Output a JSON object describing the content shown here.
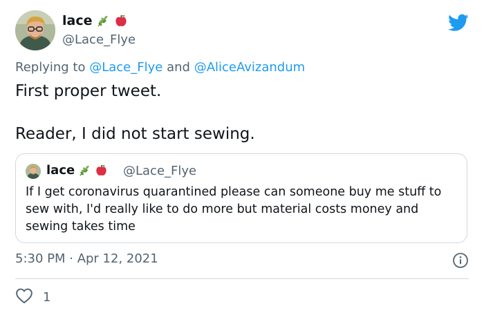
{
  "author": {
    "name": "lace",
    "handle": "@Lace_Flye",
    "emojis": [
      "herb-icon",
      "apple-icon"
    ]
  },
  "reply_context": {
    "prefix": "Replying to",
    "mention1": "@Lace_Flye",
    "conjunction": "and",
    "mention2": "@AliceAvizandum"
  },
  "tweet": {
    "line1": "First proper tweet.",
    "line2": "Reader, I did not start sewing."
  },
  "quoted_tweet": {
    "name": "lace",
    "handle": "@Lace_Flye",
    "text": "If I get coronavirus quarantined please can someone buy me stuff to sew with, I'd really like to do more but material costs money and sewing takes time"
  },
  "meta": {
    "timestamp": "5:30 PM · Apr 12, 2021"
  },
  "actions": {
    "like_count": "1"
  },
  "colors": {
    "brand": "#1d9bf0",
    "text_primary": "#0f1419",
    "text_secondary": "#536471",
    "border": "#cfd9de"
  }
}
